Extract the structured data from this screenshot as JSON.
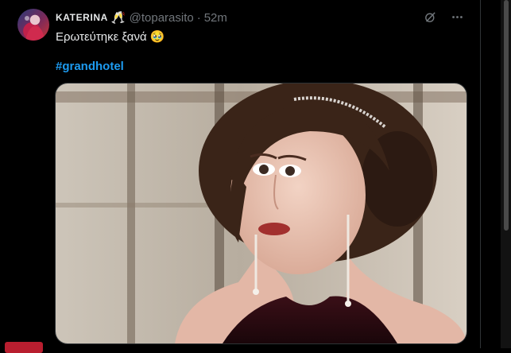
{
  "tweet": {
    "author": {
      "display_name": "KATERINA",
      "badge_emoji": "🥂",
      "handle": "@toparasito",
      "separator": "·",
      "time": "52m"
    },
    "text": "Ερωτεύτηκε ξανά 🥹",
    "hashtag": "#grandhotel",
    "media": {
      "type": "photo",
      "description": "still image"
    },
    "actions": {
      "grok_icon": "grok-icon",
      "more_icon": "more-icon"
    }
  },
  "colors": {
    "background": "#000000",
    "text": "#e7e9ea",
    "muted": "#71767b",
    "link": "#1d9bf0",
    "badge": "#b81e2f"
  }
}
